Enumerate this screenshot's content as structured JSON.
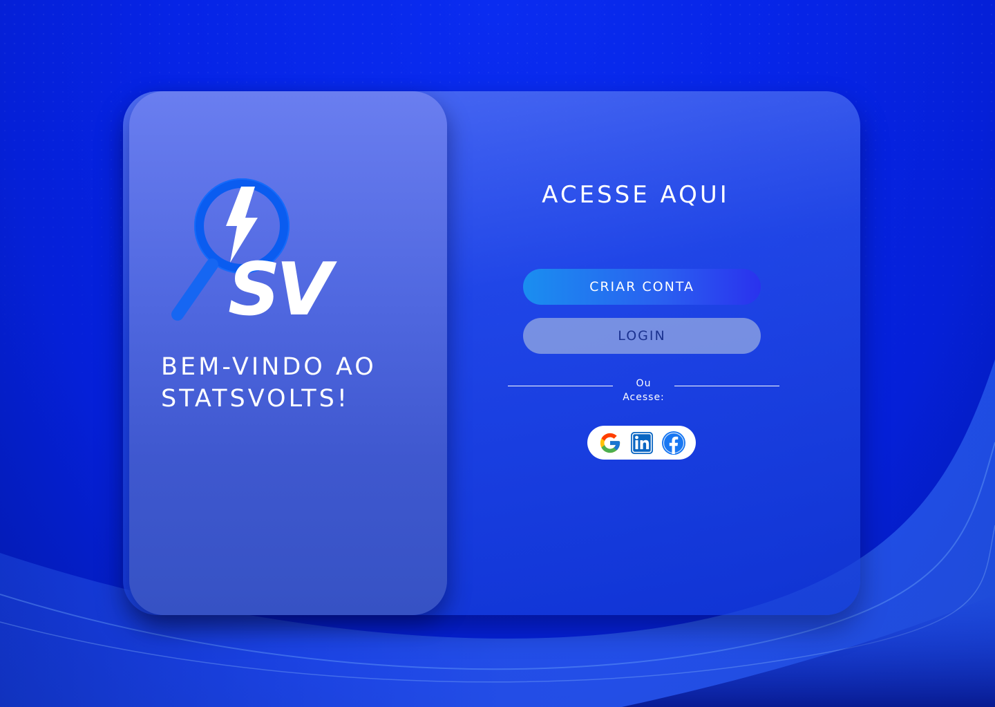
{
  "colors": {
    "background": "#0624e6",
    "accent": "#2a5ef0",
    "login_text": "#1b3290",
    "white": "#ffffff"
  },
  "brand": {
    "logo_icon": "statsvolts-logo-magnifier-bolt-sv"
  },
  "left": {
    "welcome_line1": "BEM-VINDO AO",
    "welcome_line2": "STATSVOLTS!"
  },
  "right": {
    "title": "ACESSE AQUI",
    "create_account": "CRIAR CONTA",
    "login": "LOGIN",
    "or_line1": "Ou",
    "or_line2": "Acesse:",
    "social": [
      {
        "icon": "google-icon"
      },
      {
        "icon": "linkedin-icon"
      },
      {
        "icon": "facebook-icon"
      }
    ]
  }
}
